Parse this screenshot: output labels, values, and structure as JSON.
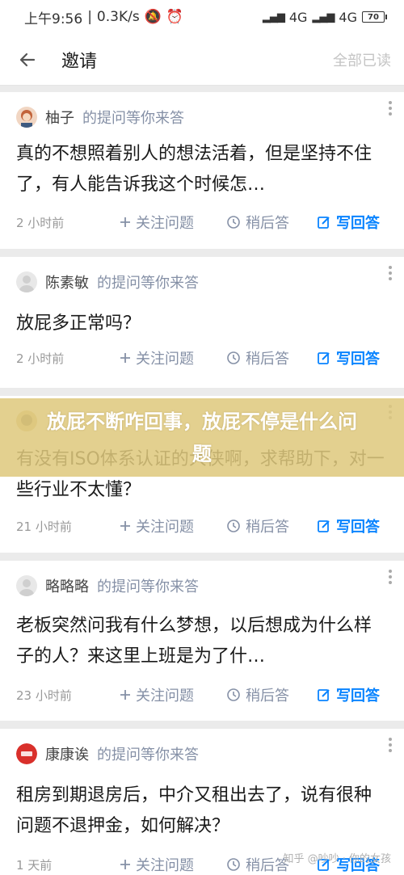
{
  "status_bar": {
    "time": "上午9:56",
    "speed": "0.3K/s",
    "network1": "4G",
    "network2": "4G",
    "battery": "70"
  },
  "app_bar": {
    "title": "邀请",
    "ignore_all": "全部已读"
  },
  "actions": {
    "follow": "关注问题",
    "later": "稍后答",
    "answer": "写回答"
  },
  "invites": [
    {
      "asker": "柚子",
      "suffix": "的提问等你来答",
      "question": "真的不想照着别人的想法活着，但是坚持不住了，有人能告诉我这个时候怎…",
      "time": "2 小时前"
    },
    {
      "asker": "陈素敏",
      "suffix": "的提问等你来答",
      "question": "放屁多正常吗？",
      "time": "2 小时前"
    },
    {
      "asker": "",
      "suffix": "",
      "question": "有没有ISO体系认证的大侠啊，求帮助下，对一些行业不太懂？",
      "time": "21 小时前"
    },
    {
      "asker": "略略略",
      "suffix": "的提问等你来答",
      "question": "老板突然问我有什么梦想，以后想成为什么样子的人？来这里上班是为了什…",
      "time": "23 小时前"
    },
    {
      "asker": "康康诶",
      "suffix": "的提问等你来答",
      "question": "租房到期退房后，中介又租出去了，说有很种问题不退押金，如何解决？",
      "time": "1 天前"
    }
  ],
  "banner": {
    "text": "放屁不断咋回事，放屁不停是什么问题"
  },
  "watermark": "知乎 @吵吵 · 你的女孩"
}
